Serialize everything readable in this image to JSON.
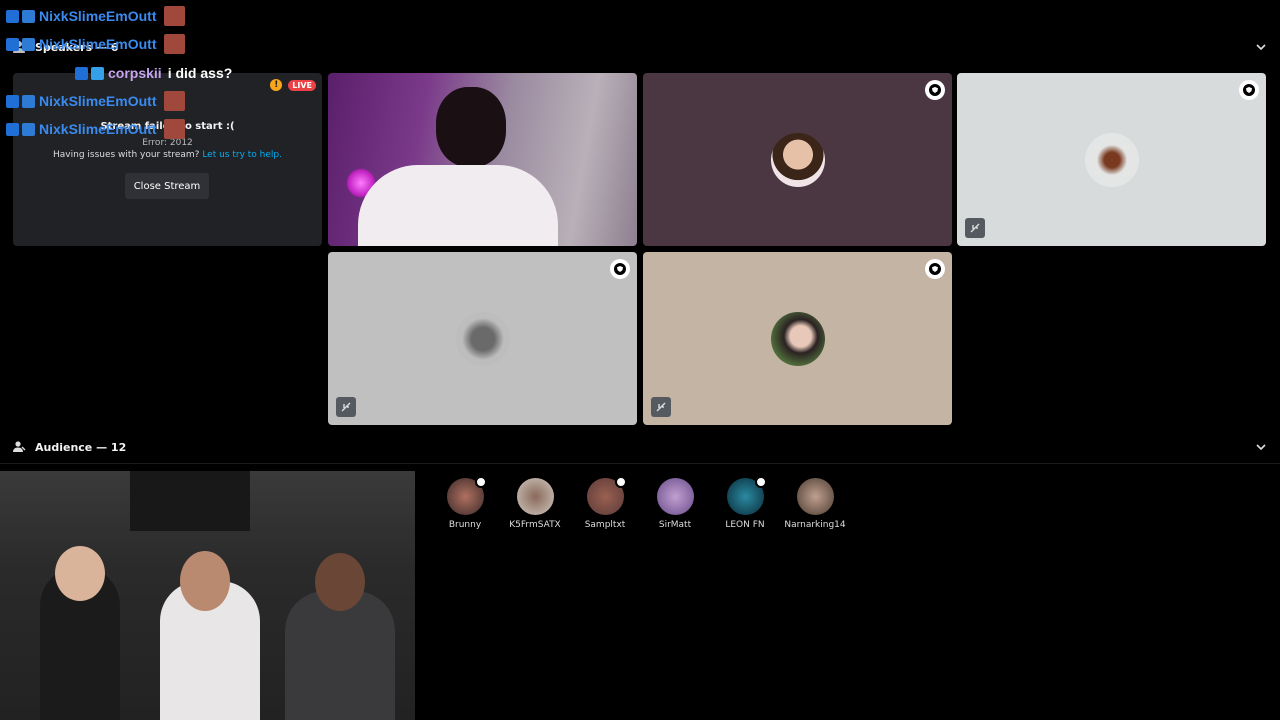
{
  "speakers_section": {
    "label": "Speakers — 6"
  },
  "error_panel": {
    "title": "Stream failed to start :(",
    "code": "Error: 2012",
    "help_prefix": "Having issues with your stream?",
    "help_link": "Let us try to help.",
    "close_button": "Close Stream",
    "live_badge": "LIVE",
    "warning": "!"
  },
  "audience_section": {
    "label": "Audience — 12"
  },
  "audience": [
    {
      "name": "Brunny"
    },
    {
      "name": "K5FrmSATX"
    },
    {
      "name": "Sampltxt"
    },
    {
      "name": "SirMatt"
    },
    {
      "name": "LEON FN"
    },
    {
      "name": "Narnarking14"
    }
  ],
  "chat": [
    {
      "user": "NixkSlimeEmOutt"
    },
    {
      "user": "NixkSlimeEmOutt"
    },
    {
      "user": "corpskii",
      "message": "i did ass?"
    },
    {
      "user": "NixkSlimeEmOutt"
    },
    {
      "user": "NixkSlimeEmOutt"
    }
  ],
  "colors": {
    "background": "#000000",
    "panel": "#202225",
    "live": "#ed4245",
    "link": "#00aff4"
  }
}
